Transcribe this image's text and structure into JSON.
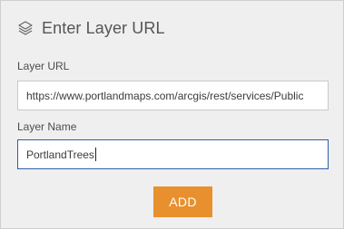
{
  "header": {
    "icon": "layers-icon",
    "title": "Enter Layer URL"
  },
  "form": {
    "url_label": "Layer URL",
    "url_value": "https://www.portlandmaps.com/arcgis/rest/services/Public",
    "name_label": "Layer Name",
    "name_value": "PortlandTrees"
  },
  "actions": {
    "add_label": "ADD"
  },
  "colors": {
    "panel_bg": "#efefef",
    "accent_button": "#e8902e",
    "focus_border": "#2e5fa8"
  }
}
